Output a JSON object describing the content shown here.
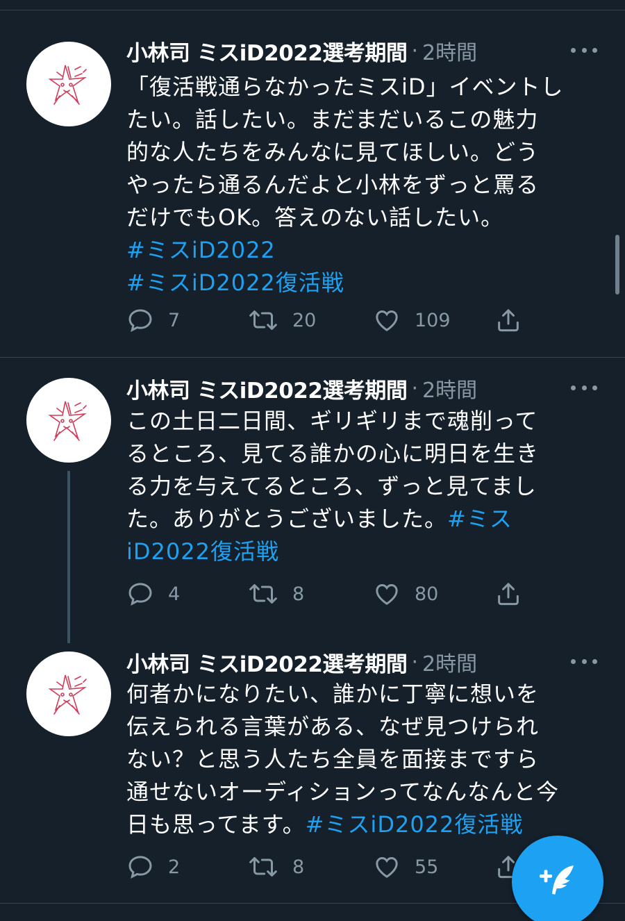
{
  "tweets": [
    {
      "author": "小林司 ミスiD2022選考期間",
      "separator": "·",
      "time": "2時間",
      "lines": [
        [
          {
            "text": "「復活戦通らなかったミスiD」イベントし",
            "tag": false
          }
        ],
        [
          {
            "text": "たい。話したい。まだまだいるこの魅力",
            "tag": false
          }
        ],
        [
          {
            "text": "的な人たちをみんなに見てほしい。どう",
            "tag": false
          }
        ],
        [
          {
            "text": "やったら通るんだよと小林をずっと罵る",
            "tag": false
          }
        ],
        [
          {
            "text": "だけでもOK。答えのない話したい。",
            "tag": false
          }
        ],
        [
          {
            "text": "#ミスiD2022",
            "tag": true
          }
        ],
        [
          {
            "text": "#ミスiD2022復活戦",
            "tag": true
          }
        ]
      ],
      "replies": "7",
      "retweets": "20",
      "likes": "109"
    },
    {
      "author": "小林司 ミスiD2022選考期間",
      "separator": "·",
      "time": "2時間",
      "lines": [
        [
          {
            "text": "この土日二日間、ギリギリまで魂削って",
            "tag": false
          }
        ],
        [
          {
            "text": "るところ、見てる誰かの心に明日を生き",
            "tag": false
          }
        ],
        [
          {
            "text": "る力を与えてるところ、ずっと見てまし",
            "tag": false
          }
        ],
        [
          {
            "text": "た。ありがとうございました。",
            "tag": false
          },
          {
            "text": "#ミス",
            "tag": true
          }
        ],
        [
          {
            "text": "iD2022復活戦",
            "tag": true
          }
        ]
      ],
      "replies": "4",
      "retweets": "8",
      "likes": "80"
    },
    {
      "author": "小林司 ミスiD2022選考期間",
      "separator": "·",
      "time": "2時間",
      "lines": [
        [
          {
            "text": "何者かになりたい、誰かに丁寧に想いを",
            "tag": false
          }
        ],
        [
          {
            "text": "伝えられる言葉がある、なぜ見つけられ",
            "tag": false
          }
        ],
        [
          {
            "text": "ない？と思う人たち全員を面接まですら",
            "tag": false
          }
        ],
        [
          {
            "text": "通せないオーディションってなんなんと今",
            "tag": false
          }
        ],
        [
          {
            "text": "日も思ってます。",
            "tag": false
          },
          {
            "text": "#ミスiD2022復活戦",
            "tag": true
          }
        ]
      ],
      "replies": "2",
      "retweets": "8",
      "likes": "55"
    }
  ],
  "icons": {
    "reply": "reply-icon",
    "retweet": "retweet-icon",
    "like": "heart-icon",
    "share": "share-icon",
    "more": "more-icon",
    "compose": "compose-tweet-icon"
  },
  "colors": {
    "background": "#15202b",
    "text": "#ffffff",
    "secondary": "#8899a6",
    "accent": "#1da1f2",
    "divider": "#38444d"
  }
}
